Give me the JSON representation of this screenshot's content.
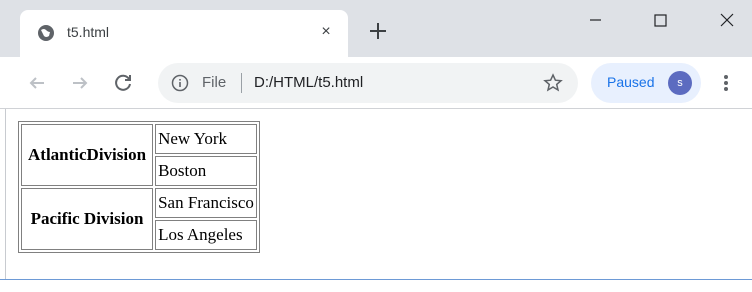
{
  "browser": {
    "tab": {
      "title": "t5.html",
      "close_glyph": "×",
      "icon": "globe-icon"
    },
    "new_tab_glyph": "+",
    "window_controls": [
      "minimize",
      "maximize",
      "close"
    ],
    "omnibox": {
      "scheme_label": "File",
      "url": "D:/HTML/t5.html"
    },
    "profile": {
      "status_label": "Paused",
      "avatar_initial": "s"
    }
  },
  "page": {
    "table": {
      "groups": [
        {
          "division": "AtlanticDivision",
          "cities": [
            "New York",
            "Boston"
          ]
        },
        {
          "division": "Pacific Division",
          "cities": [
            "San Francisco",
            "Los Angeles"
          ]
        }
      ]
    }
  }
}
